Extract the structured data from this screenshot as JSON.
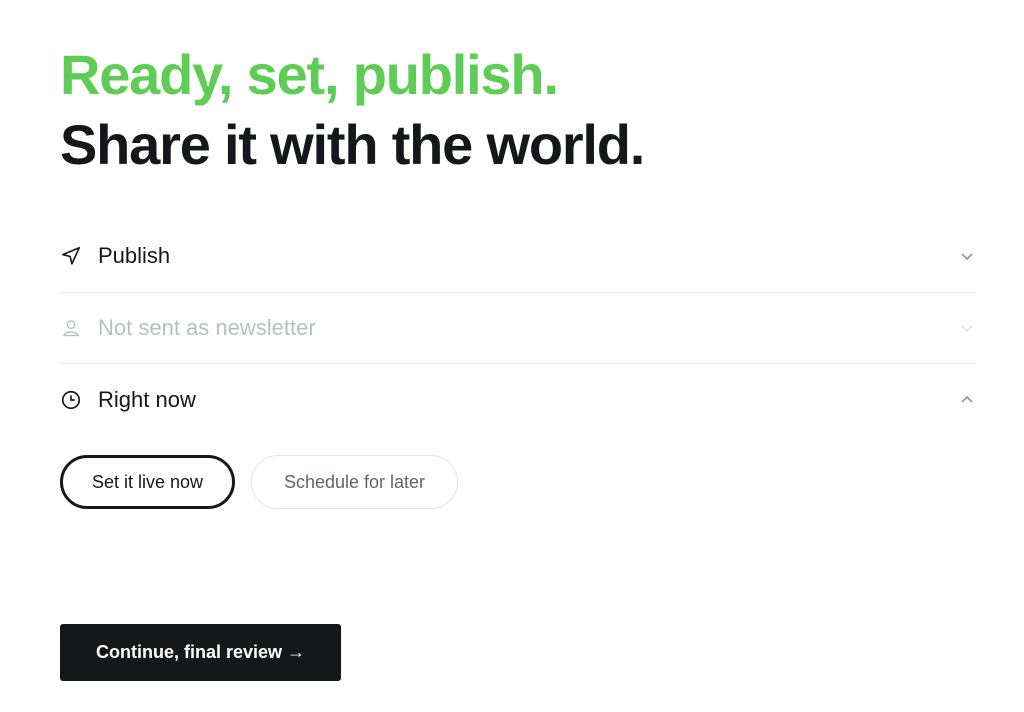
{
  "headline": {
    "line1": "Ready, set, publish.",
    "line2": "Share it with the world."
  },
  "settings": {
    "publish": {
      "label": "Publish",
      "icon": "send-arrow-icon",
      "chevron": "chevron-down"
    },
    "newsletter": {
      "label": "Not sent as newsletter",
      "icon": "user-icon",
      "chevron": "chevron-down",
      "disabled": true
    },
    "timing": {
      "label": "Right now",
      "icon": "clock-icon",
      "chevron": "chevron-up"
    }
  },
  "timing_options": {
    "now_label": "Set it live now",
    "later_label": "Schedule for later",
    "selected": "now"
  },
  "cta": {
    "label": "Continue, final review →"
  },
  "colors": {
    "accent": "#5fcc55",
    "text": "#15171a",
    "muted": "#b9bec3",
    "border": "#e6e8ea"
  }
}
